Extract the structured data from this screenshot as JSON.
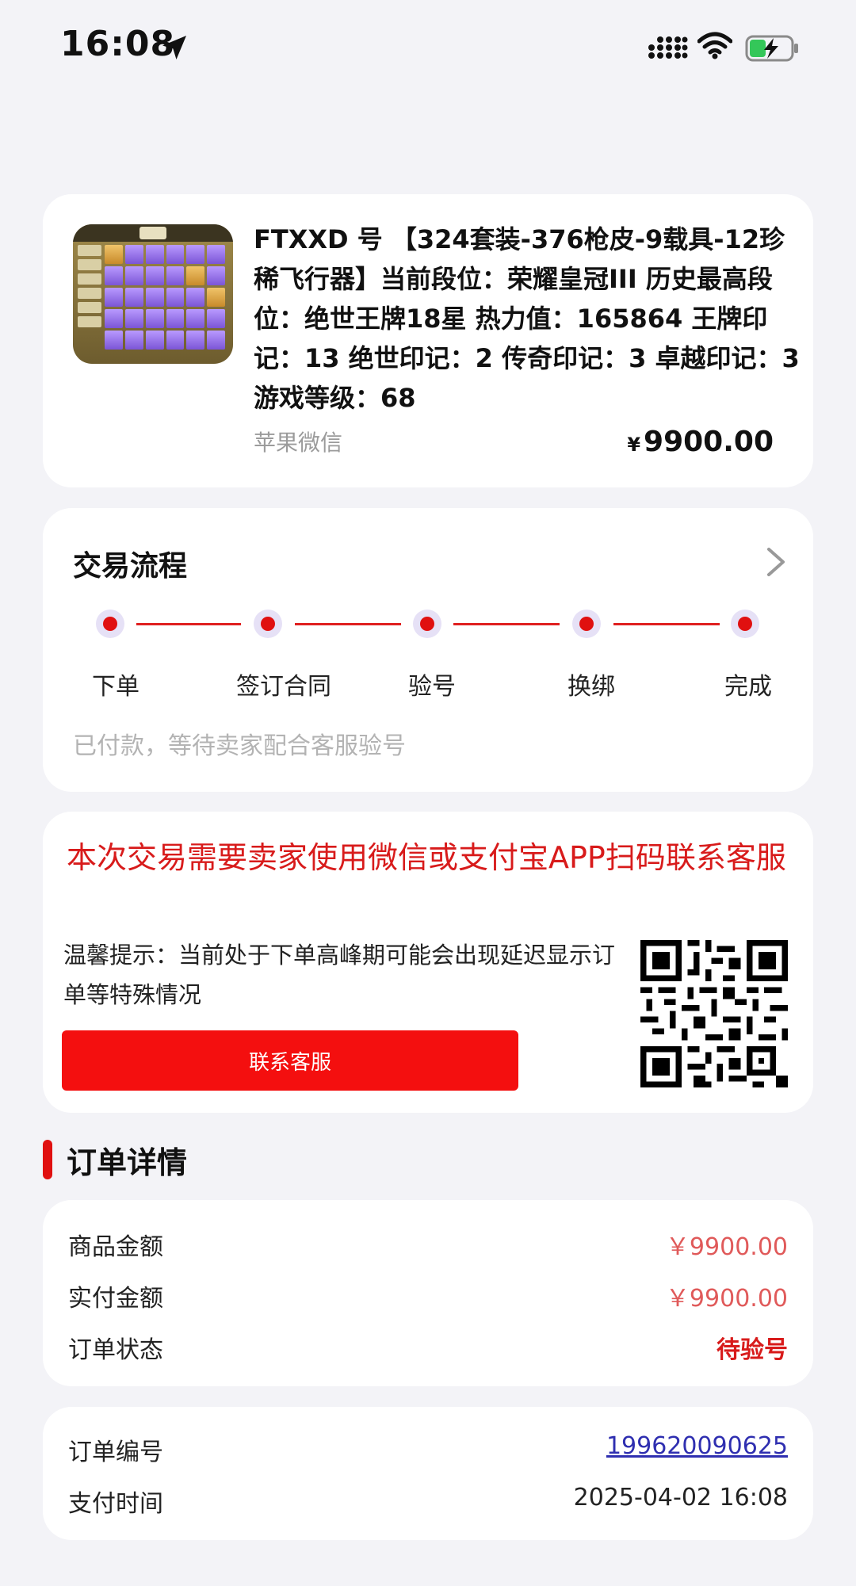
{
  "status_bar": {
    "time": "16:08"
  },
  "product": {
    "title": "FTXXD 号 【324套装-376枪皮-9载具-12珍稀飞行器】当前段位：荣耀皇冠III 历史最高段位：绝世王牌18星 热力值：165864 王牌印记：13 绝世印记：2 传奇印记：3 卓越印记：3 游戏等级：68",
    "subtitle": "苹果微信",
    "currency": "¥",
    "price": "9900.00"
  },
  "process": {
    "title": "交易流程",
    "steps": [
      {
        "label": "下单"
      },
      {
        "label": "签订合同"
      },
      {
        "label": "验号"
      },
      {
        "label": "换绑"
      },
      {
        "label": "完成"
      }
    ],
    "note": "已付款，等待卖家配合客服验号"
  },
  "contact": {
    "title": "本次交易需要卖家使用微信或支付宝APP扫码联系客服",
    "tip": "温馨提示：当前处于下单高峰期可能会出现延迟显示订单等特殊情况",
    "button_label": "联系客服"
  },
  "order_details": {
    "header": "订单详情",
    "goods_amount_label": "商品金额",
    "goods_amount_value": "￥9900.00",
    "paid_amount_label": "实付金额",
    "paid_amount_value": "￥9900.00",
    "status_label": "订单状态",
    "status_value": "待验号",
    "order_no_label": "订单编号",
    "order_no_value": "199620090625",
    "pay_time_label": "支付时间",
    "pay_time_value": "2025-04-02 16:08"
  },
  "colors": {
    "accent_red": "#e01010",
    "button_red": "#f40f0f",
    "link_blue": "#2f2fb0"
  },
  "icons": [
    "location-arrow-icon",
    "signal-icon",
    "wifi-icon",
    "battery-charging-icon",
    "chevron-right-icon",
    "qr-code-icon"
  ]
}
